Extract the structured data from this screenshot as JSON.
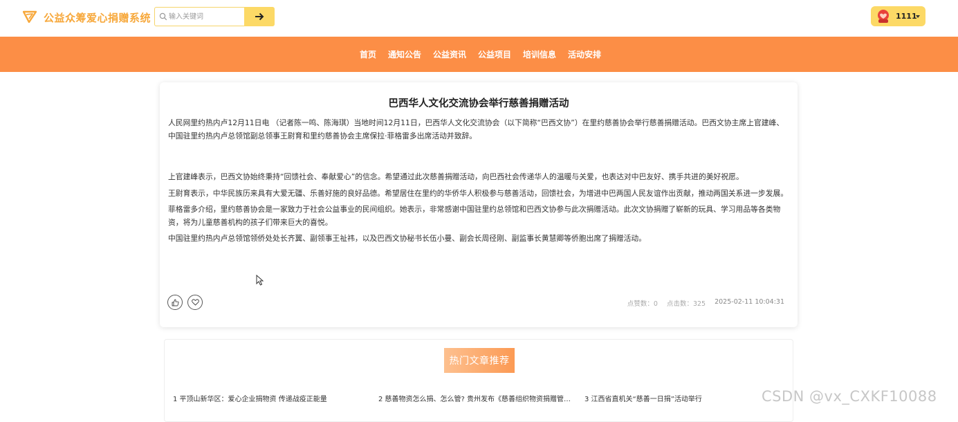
{
  "header": {
    "site_title": "公益众筹爱心捐赠系统",
    "logo_icon": "send-triangle-icon",
    "search_placeholder": "输入关键词",
    "search_button_icon": "arrow-right-icon",
    "username": "1111",
    "accent_color": "#fcd966",
    "title_color": "#f7a83b"
  },
  "nav": {
    "bg_color": "#fc8e46",
    "items": [
      "首页",
      "通知公告",
      "公益资讯",
      "公益项目",
      "培训信息",
      "活动安排"
    ]
  },
  "article": {
    "title": "巴西华人文化交流协会举行慈善捐赠活动",
    "paragraphs": [
      "人民网里约热内卢12月11日电 （记者陈一鸣、陈海琪）当地时间12月11日，巴西华人文化交流协会（以下简称“巴西文协”）在里约慈善协会举行慈善捐赠活动。巴西文协主席上官建峰、中国驻里约热内卢总领馆副总领事王尉育和里约慈善协会主席保拉·菲格雷多出席活动并致辞。",
      "上官建峰表示，巴西文协始终秉持“回馈社会、奉献爱心”的信念。希望通过此次慈善捐赠活动，向巴西社会传递华人的温暖与关爱，也表达对中巴友好、携手共进的美好祝愿。",
      "王尉育表示，中华民族历来具有大爱无疆、乐善好施的良好品德。希望居住在里约的华侨华人积极参与慈善活动，回馈社会，为增进中巴两国人民友谊作出贡献，推动两国关系进一步发展。",
      "菲格雷多介绍，里约慈善协会是一家致力于社会公益事业的民间组织。她表示，非常感谢中国驻里约总领馆和巴西文协参与此次捐赠活动。此次文协捐赠了崭新的玩具、学习用品等各类物资，将为儿童慈善机构的孩子们带来巨大的喜悦。",
      "中国驻里约热内卢总领馆领侨处处长齐翼、副领事王祉祎，以及巴西文协秘书长伍小曼、副会长周径刚、副监事长黄慧卿等侨胞出席了捐赠活动。"
    ],
    "like_icon": "thumbs-up-icon",
    "favorite_icon": "heart-icon",
    "likes_text": "点赞数：0",
    "clicks_text": "点击数：325",
    "date": "2025-02-11 10:04:31"
  },
  "hot": {
    "title": "热门文章推荐",
    "items": [
      "1  平顶山新华区：爱心企业捐物资 传递战疫正能量",
      "2  慈善物资怎么捐、怎么管? 贵州发布《慈善组织物资捐赠管…",
      "3  江西省直机关“慈善一日捐”活动举行"
    ]
  },
  "watermark": "CSDN @vx_CXKF10088"
}
